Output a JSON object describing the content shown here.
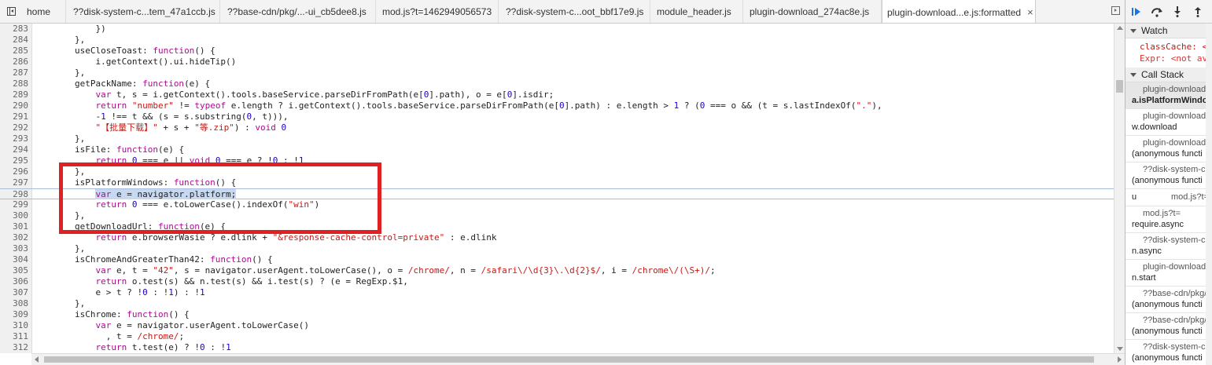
{
  "tabs": [
    {
      "label": "home",
      "active": false
    },
    {
      "label": "??disk-system-c...tem_47a1ccb.js",
      "active": false
    },
    {
      "label": "??base-cdn/pkg/...-ui_cb5dee8.js",
      "active": false
    },
    {
      "label": "mod.js?t=1462949056573",
      "active": false
    },
    {
      "label": "??disk-system-c...oot_bbf17e9.js",
      "active": false
    },
    {
      "label": "module_header.js",
      "active": false
    },
    {
      "label": "plugin-download_274ac8e.js",
      "active": false
    },
    {
      "label": "plugin-download...e.js:formatted",
      "active": true
    }
  ],
  "tab_close_glyph": "×",
  "current_line": 298,
  "code_lines": [
    {
      "n": 283,
      "html": "            })"
    },
    {
      "n": 284,
      "html": "        },"
    },
    {
      "n": 285,
      "html": "        useCloseToast: <span class=\"kw\">function</span>() {"
    },
    {
      "n": 286,
      "html": "            i.getContext().ui.hideTip()"
    },
    {
      "n": 287,
      "html": "        },"
    },
    {
      "n": 288,
      "html": "        getPackName: <span class=\"kw\">function</span>(e) {"
    },
    {
      "n": 289,
      "html": "            <span class=\"kw\">var</span> t, s = i.getContext().tools.baseService.parseDirFromPath(e[<span class=\"num\">0</span>].path), o = e[<span class=\"num\">0</span>].isdir;"
    },
    {
      "n": 290,
      "html": "            <span class=\"kw\">return</span> <span class=\"str\">\"number\"</span> != <span class=\"kw\">typeof</span> e.length ? i.getContext().tools.baseService.parseDirFromPath(e[<span class=\"num\">0</span>].path) : e.length > <span class=\"num\">1</span> ? (<span class=\"num\">0</span> === o && (t = s.lastIndexOf(<span class=\"str\">\".\"</span>),"
    },
    {
      "n": 291,
      "html": "            -<span class=\"num\">1</span> !== t && (s = s.substring(<span class=\"num\">0</span>, t))),"
    },
    {
      "n": 292,
      "html": "            <span class=\"str\">\"【批量下载】\"</span> + s + <span class=\"str\">\"等.zip\"</span>) : <span class=\"kw\">void</span> <span class=\"num\">0</span>"
    },
    {
      "n": 293,
      "html": "        },"
    },
    {
      "n": 294,
      "html": "        isFile: <span class=\"kw\">function</span>(e) {"
    },
    {
      "n": 295,
      "html": "            <span class=\"kw\">return</span> <span class=\"num\">0</span> === e || <span class=\"kw\">void</span> <span class=\"num\">0</span> === e ? !<span class=\"num\">0</span> : !<span class=\"num\">1</span>"
    },
    {
      "n": 296,
      "html": "        },"
    },
    {
      "n": 297,
      "html": "        isPlatformWindows: <span class=\"kw\">function</span>() {"
    },
    {
      "n": 298,
      "html": "            <span class=\"sel\"><span class=\"kw\">var</span> e = navigator.platform;</span>"
    },
    {
      "n": 299,
      "html": "            <span class=\"kw\">return</span> <span class=\"num\">0</span> === e.toLowerCase().indexOf(<span class=\"str\">\"win\"</span>)"
    },
    {
      "n": 300,
      "html": "        },"
    },
    {
      "n": 301,
      "html": "        getDownloadUrl: <span class=\"kw\">function</span>(e) {"
    },
    {
      "n": 302,
      "html": "            <span class=\"kw\">return</span> e.browserWasie ? e.dlink + <span class=\"str\">\"&response-cache-control=private\"</span> : e.dlink"
    },
    {
      "n": 303,
      "html": "        },"
    },
    {
      "n": 304,
      "html": "        isChromeAndGreaterThan42: <span class=\"kw\">function</span>() {"
    },
    {
      "n": 305,
      "html": "            <span class=\"kw\">var</span> e, t = <span class=\"str\">\"42\"</span>, s = navigator.userAgent.toLowerCase(), o = <span class=\"rx\">/chrome/</span>, n = <span class=\"rx\">/safari\\/\\d{3}\\.\\d{2}$/</span>, i = <span class=\"rx\">/chrome\\/(\\S+)/</span>;"
    },
    {
      "n": 306,
      "html": "            <span class=\"kw\">return</span> o.test(s) && n.test(s) && i.test(s) ? (e = RegExp.$1,"
    },
    {
      "n": 307,
      "html": "            e > t ? !<span class=\"num\">0</span> : !<span class=\"num\">1</span>) : !<span class=\"num\">1</span>"
    },
    {
      "n": 308,
      "html": "        },"
    },
    {
      "n": 309,
      "html": "        isChrome: <span class=\"kw\">function</span>() {"
    },
    {
      "n": 310,
      "html": "            <span class=\"kw\">var</span> e = navigator.userAgent.toLowerCase()"
    },
    {
      "n": 311,
      "html": "              , t = <span class=\"rx\">/chrome/</span>;"
    },
    {
      "n": 312,
      "html": "            <span class=\"kw\">return</span> t.test(e) ? !<span class=\"num\">0</span> : !<span class=\"num\">1</span>"
    },
    {
      "n": 313,
      "html": "        },"
    }
  ],
  "debugger": {
    "watch_title": "Watch",
    "watch_lines": [
      "classCache: <n",
      "Expr: <not ava"
    ],
    "callstack_title": "Call Stack",
    "frames": [
      {
        "loc": "plugin-download",
        "name": "a.isPlatformWindo",
        "selected": true
      },
      {
        "loc": "plugin-download",
        "name": "w.download",
        "selected": false
      },
      {
        "loc": "plugin-download",
        "name": "(anonymous functi",
        "selected": false
      },
      {
        "loc": "??disk-system-c",
        "name": "(anonymous functi",
        "selected": false
      },
      {
        "loc": "mod.js?t=",
        "name": "u",
        "selected": false,
        "single": true
      },
      {
        "loc": "mod.js?t=",
        "name": "require.async",
        "selected": false
      },
      {
        "loc": "??disk-system-c",
        "name": "n.async",
        "selected": false
      },
      {
        "loc": "plugin-download",
        "name": "n.start",
        "selected": false
      },
      {
        "loc": "??base-cdn/pkg/",
        "name": "(anonymous functi",
        "selected": false
      },
      {
        "loc": "??base-cdn/pkg/",
        "name": "(anonymous functi",
        "selected": false
      },
      {
        "loc": "??disk-system-c",
        "name": "(anonymous functi",
        "selected": false
      }
    ]
  },
  "colors": {
    "annotation_box": "#e02121",
    "keyword": "#aa0d91",
    "string": "#c41a16",
    "number": "#1c00cf"
  }
}
